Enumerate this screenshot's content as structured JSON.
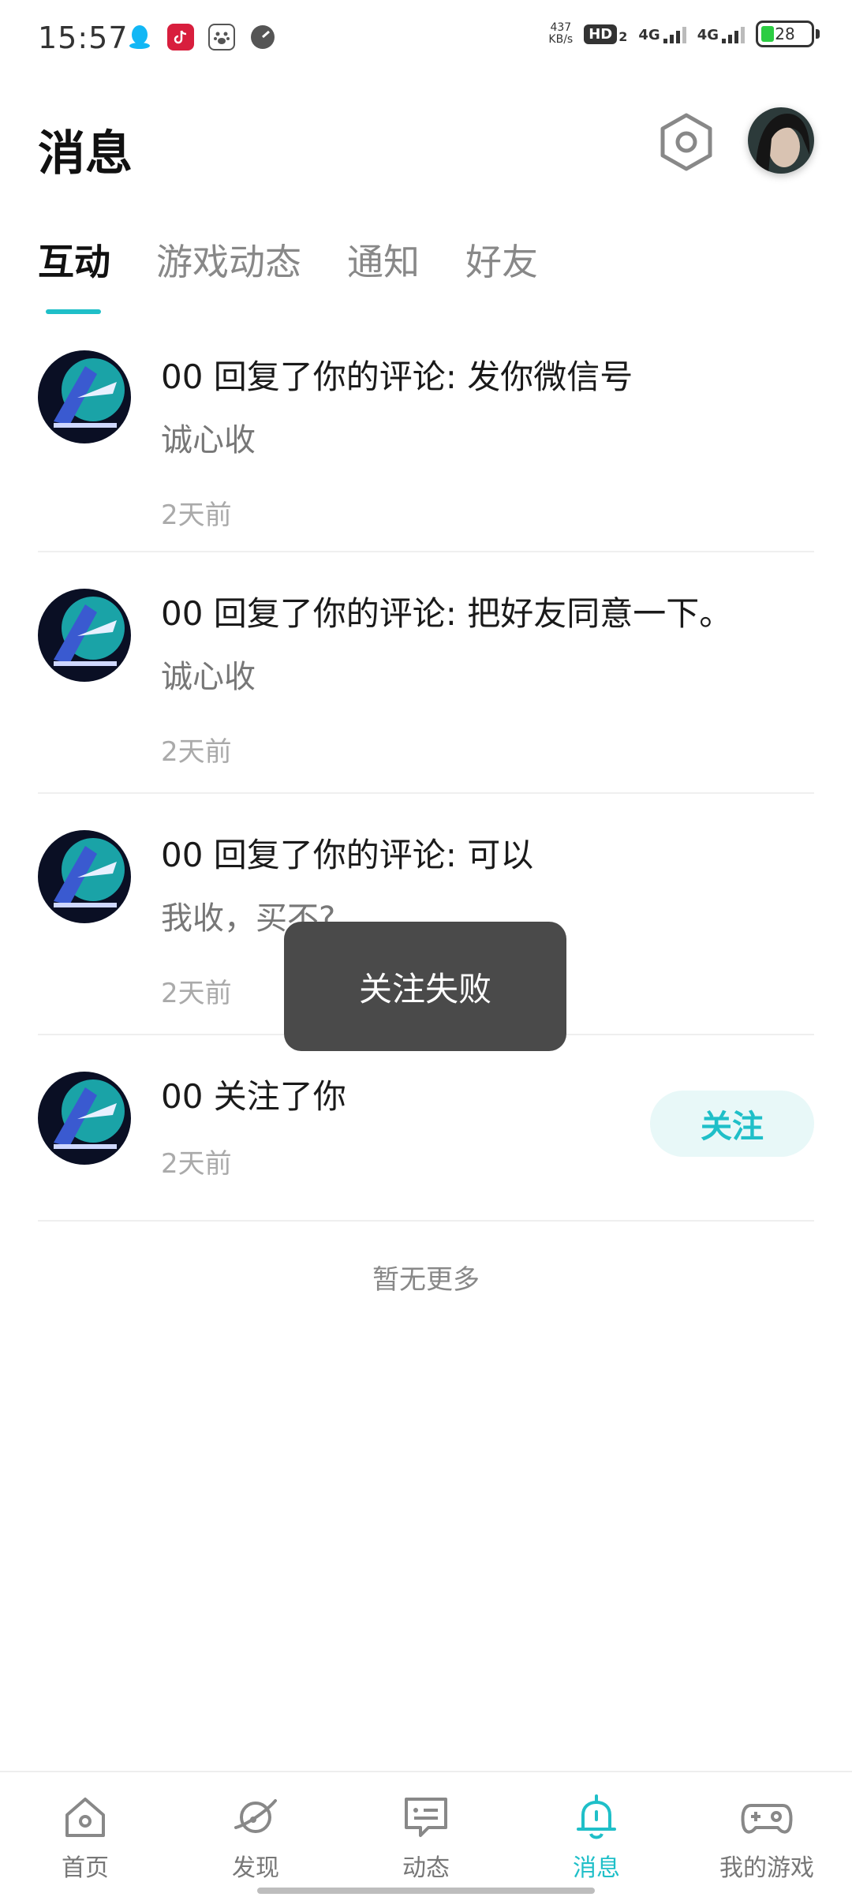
{
  "status_bar": {
    "time": "15:57",
    "net_speed_value": "437",
    "net_speed_unit": "KB/s",
    "hd_label": "HD",
    "hd_sub": "2",
    "network1": "4G",
    "network2": "4G",
    "battery": "28",
    "app_icons": [
      "qq-icon",
      "douyin-icon",
      "baidu-icon",
      "speedometer-icon"
    ]
  },
  "header": {
    "title": "消息"
  },
  "tabs": [
    {
      "label": "互动",
      "active": true
    },
    {
      "label": "游戏动态",
      "active": false
    },
    {
      "label": "通知",
      "active": false
    },
    {
      "label": "好友",
      "active": false
    }
  ],
  "messages": [
    {
      "title": "00 回复了你的评论: 发你微信号",
      "reply": "诚心收",
      "time": "2天前"
    },
    {
      "title": "00 回复了你的评论: 把好友同意一下。",
      "reply": "诚心收",
      "time": "2天前"
    },
    {
      "title": "00 回复了你的评论: 可以",
      "reply": "我收，买不?",
      "time": "2天前"
    },
    {
      "title": "00 关注了你",
      "time": "2天前",
      "button": "关注"
    }
  ],
  "footer_text": "暂无更多",
  "toast": "关注失败",
  "bottom_nav": [
    {
      "label": "首页",
      "icon": "home-icon",
      "active": false
    },
    {
      "label": "发现",
      "icon": "planet-icon",
      "active": false
    },
    {
      "label": "动态",
      "icon": "feed-icon",
      "active": false
    },
    {
      "label": "消息",
      "icon": "bell-icon",
      "active": true
    },
    {
      "label": "我的游戏",
      "icon": "gamepad-icon",
      "active": false
    }
  ],
  "colors": {
    "accent": "#1fbfc8",
    "toast_bg": "#4a4a4a",
    "follow_bg": "#e8f8f8"
  }
}
